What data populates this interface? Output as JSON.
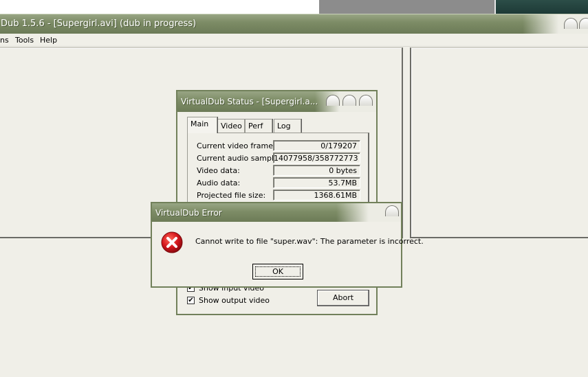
{
  "main_window": {
    "title": "Dub 1.5.6 - [Supergirl.avi] (dub in progress)",
    "menu": [
      "ns",
      "Tools",
      "Help"
    ]
  },
  "status_dialog": {
    "title": "VirtualDub Status - [Supergirl.a...",
    "tabs": [
      "Main",
      "Video",
      "Perf",
      "Log"
    ],
    "active_tab": "Main",
    "stats": [
      {
        "label": "Current video frame:",
        "value": "0/179207"
      },
      {
        "label": "Current audio sample:",
        "value": "14077958/358772773"
      },
      {
        "label": "Video data:",
        "value": "0 bytes"
      },
      {
        "label": "Audio data:",
        "value": "53.7MB"
      },
      {
        "label": "Projected file size:",
        "value": "1368.61MB"
      }
    ],
    "show_input_video": {
      "label": "Show input video",
      "checked": true
    },
    "show_output_video": {
      "label": "Show output video",
      "checked": true
    },
    "abort_label": "Abort"
  },
  "error_dialog": {
    "title": "VirtualDub Error",
    "message": "Cannot write to file \"super.wav\": The parameter is incorrect.",
    "ok_label": "OK",
    "icon": "error-icon"
  },
  "colors": {
    "titlebar": "#7d8c66",
    "error_red": "#c8161d",
    "background": "#f0efe8"
  }
}
